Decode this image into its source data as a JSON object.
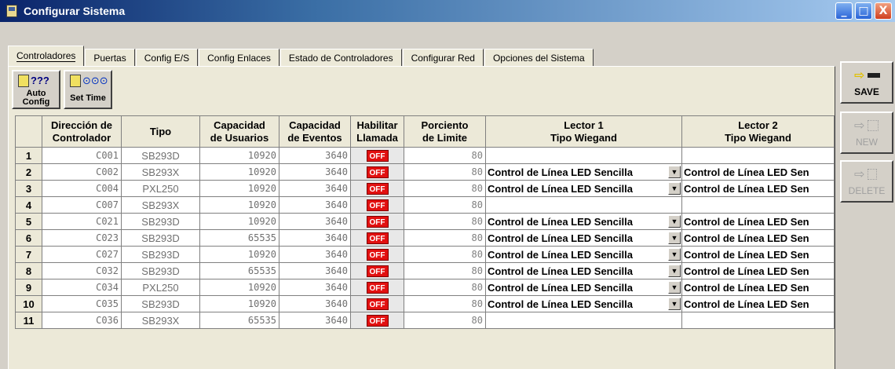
{
  "window": {
    "title": "Configurar Sistema",
    "buttons": {
      "minimize": "_",
      "maximize": "□",
      "close": "X"
    }
  },
  "tabs": [
    {
      "label": "Controladores",
      "active": true
    },
    {
      "label": "Puertas"
    },
    {
      "label": "Config E/S"
    },
    {
      "label": "Config Enlaces"
    },
    {
      "label": "Estado de Controladores"
    },
    {
      "label": "Configurar Red"
    },
    {
      "label": "Opciones del Sistema"
    }
  ],
  "toolbar": {
    "auto_config_label_1": "Auto",
    "auto_config_label_2": "Config",
    "auto_config_glyph": "???",
    "set_time_label": "Set Time",
    "set_time_glyph": "⊙⊙⊙"
  },
  "sidebar": {
    "save_label": "SAVE",
    "new_label": "NEW",
    "delete_label": "DELETE"
  },
  "grid": {
    "headers": {
      "dir1": "Dirección de",
      "dir2": "Controlador",
      "tipo": "Tipo",
      "cu1": "Capacidad",
      "cu2": "de Usuarios",
      "ce1": "Capacidad",
      "ce2": "de Eventos",
      "hl1": "Habilitar",
      "hl2": "Llamada",
      "pl1": "Porciento",
      "pl2": "de Limite",
      "l11": "Lector 1",
      "l12": "Tipo Wiegand",
      "l21": "Lector 2",
      "l22": "Tipo Wiegand"
    },
    "rows": [
      {
        "n": "1",
        "addr": "C001",
        "tipo": "SB293D",
        "usuarios": "10920",
        "eventos": "3640",
        "llamada": "OFF",
        "limite": "80",
        "lector1": "",
        "lector2": ""
      },
      {
        "n": "2",
        "addr": "C002",
        "tipo": "SB293X",
        "usuarios": "10920",
        "eventos": "3640",
        "llamada": "OFF",
        "limite": "80",
        "lector1": "Control de Línea LED Sencilla",
        "lector2": "Control de Línea LED Sen"
      },
      {
        "n": "3",
        "addr": "C004",
        "tipo": "PXL250",
        "usuarios": "10920",
        "eventos": "3640",
        "llamada": "OFF",
        "limite": "80",
        "lector1": "Control de Línea LED Sencilla",
        "lector2": "Control de Línea LED Sen"
      },
      {
        "n": "4",
        "addr": "C007",
        "tipo": "SB293X",
        "usuarios": "10920",
        "eventos": "3640",
        "llamada": "OFF",
        "limite": "80",
        "lector1": "",
        "lector2": ""
      },
      {
        "n": "5",
        "addr": "C021",
        "tipo": "SB293D",
        "usuarios": "10920",
        "eventos": "3640",
        "llamada": "OFF",
        "limite": "80",
        "lector1": "Control de Línea LED Sencilla",
        "lector2": "Control de Línea LED Sen"
      },
      {
        "n": "6",
        "addr": "C023",
        "tipo": "SB293D",
        "usuarios": "65535",
        "eventos": "3640",
        "llamada": "OFF",
        "limite": "80",
        "lector1": "Control de Línea LED Sencilla",
        "lector2": "Control de Línea LED Sen"
      },
      {
        "n": "7",
        "addr": "C027",
        "tipo": "SB293D",
        "usuarios": "10920",
        "eventos": "3640",
        "llamada": "OFF",
        "limite": "80",
        "lector1": "Control de Línea LED Sencilla",
        "lector2": "Control de Línea LED Sen"
      },
      {
        "n": "8",
        "addr": "C032",
        "tipo": "SB293D",
        "usuarios": "65535",
        "eventos": "3640",
        "llamada": "OFF",
        "limite": "80",
        "lector1": "Control de Línea LED Sencilla",
        "lector2": "Control de Línea LED Sen"
      },
      {
        "n": "9",
        "addr": "C034",
        "tipo": "PXL250",
        "usuarios": "10920",
        "eventos": "3640",
        "llamada": "OFF",
        "limite": "80",
        "lector1": "Control de Línea LED Sencilla",
        "lector2": "Control de Línea LED Sen"
      },
      {
        "n": "10",
        "addr": "C035",
        "tipo": "SB293D",
        "usuarios": "10920",
        "eventos": "3640",
        "llamada": "OFF",
        "limite": "80",
        "lector1": "Control de Línea LED Sencilla",
        "lector2": "Control de Línea LED Sen"
      },
      {
        "n": "11",
        "addr": "C036",
        "tipo": "SB293X",
        "usuarios": "65535",
        "eventos": "3640",
        "llamada": "OFF",
        "limite": "80",
        "lector1": "",
        "lector2": ""
      }
    ]
  },
  "colors": {
    "off_badge": "#e21010",
    "titlebar_start": "#0a246a",
    "titlebar_end": "#a6caf0"
  }
}
